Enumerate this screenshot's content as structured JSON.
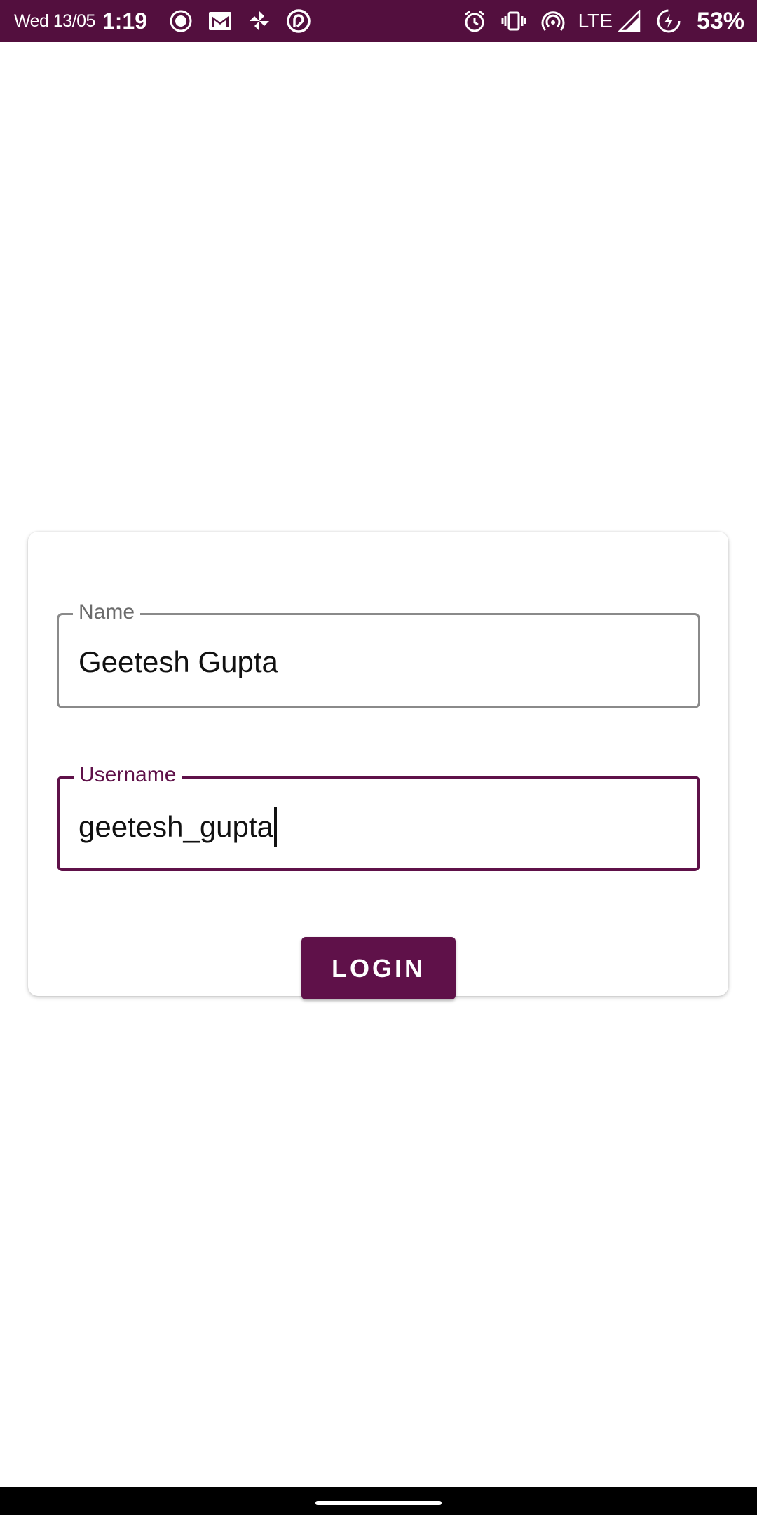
{
  "status_bar": {
    "date": "Wed 13/05",
    "time": "1:19",
    "network": "LTE",
    "battery": "53%",
    "notification_icons": [
      "record-icon",
      "gmail-icon",
      "pinwheel-icon",
      "app-icon"
    ],
    "system_icons": [
      "alarm-icon",
      "vibrate-icon",
      "hotspot-icon",
      "signal-icon",
      "battery-saver-icon"
    ],
    "background_color": "#530f3e"
  },
  "form": {
    "name": {
      "label": "Name",
      "value": "Geetesh Gupta"
    },
    "username": {
      "label": "Username",
      "value": "geetesh_gupta"
    },
    "login_button_label": "LOGIN"
  },
  "colors": {
    "accent": "#5f1149",
    "unfocused_border": "#8a8a8a",
    "label_gray": "#6b6b6b"
  }
}
